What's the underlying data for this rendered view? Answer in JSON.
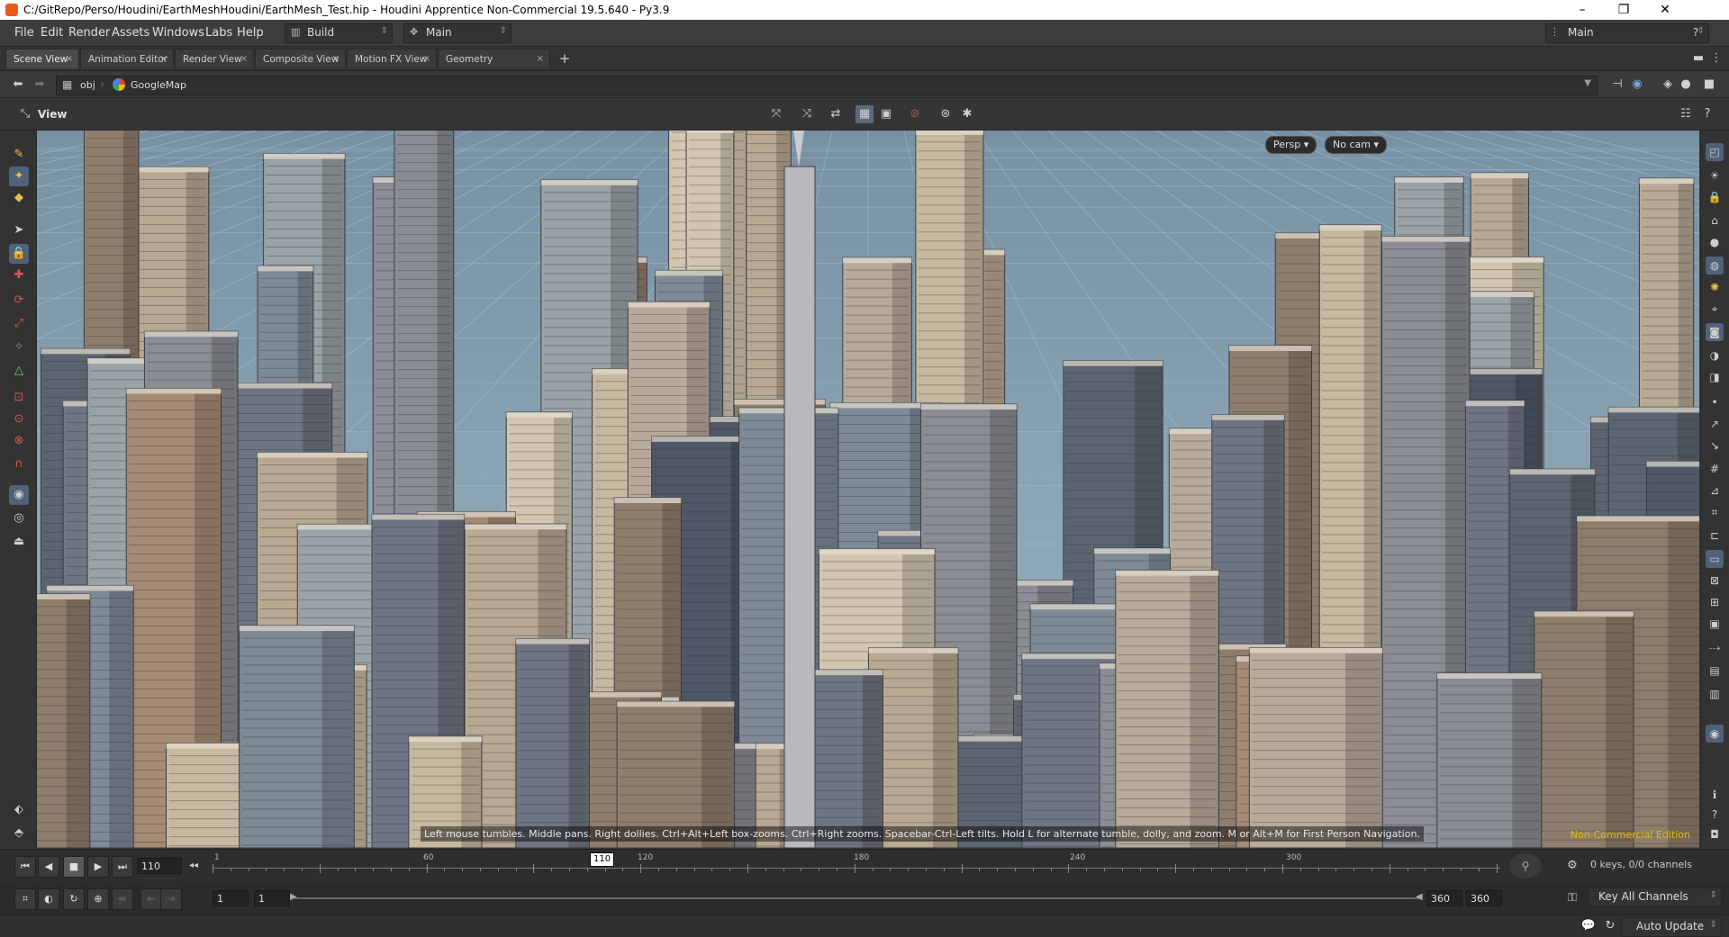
{
  "window": {
    "title": "C:/GitRepo/Perso/Houdini/EarthMeshHoudini/EarthMesh_Test.hip - Houdini Apprentice Non-Commercial 19.5.640 - Py3.9",
    "minimize": "–",
    "maximize": "❐",
    "close": "✕"
  },
  "menu": {
    "items": [
      "File",
      "Edit",
      "Render",
      "Assets",
      "Windows",
      "Labs",
      "Help"
    ],
    "desktop_combo": "Build",
    "context_combo": "Main",
    "right_combo": "Main"
  },
  "tabs": [
    {
      "label": "Scene View",
      "active": true
    },
    {
      "label": "Animation Editor",
      "active": false
    },
    {
      "label": "Render View",
      "active": false
    },
    {
      "label": "Composite View",
      "active": false
    },
    {
      "label": "Motion FX View",
      "active": false
    },
    {
      "label": "Geometry Spreadsheet",
      "active": false
    }
  ],
  "tab_add": "+",
  "path": {
    "root": "obj",
    "node": "GoogleMap"
  },
  "viewer": {
    "label": "View",
    "persp": "Persp ▾",
    "cam": "No cam ▾",
    "hint": "Left mouse tumbles. Middle pans. Right dollies. Ctrl+Alt+Left box-zooms. Ctrl+Right zooms. Spacebar-Ctrl-Left tilts. Hold L for alternate tumble, dolly, and zoom.    M or Alt+M for First Person Navigation.",
    "edition": "Non-Commercial Edition"
  },
  "timeline": {
    "current_frame": "110",
    "marker": "110",
    "ticks": [
      "1",
      "60",
      "120",
      "180",
      "240",
      "300"
    ],
    "keys_info": "0 keys, 0/0 channels",
    "key_all": "Key All Channels"
  },
  "range": {
    "start": "1",
    "start2": "1",
    "end": "360",
    "end2": "360"
  },
  "status": {
    "auto_update": "Auto Update"
  },
  "colors": {
    "accent": "#50627a",
    "sky": "#8ca6b6",
    "edition": "#e0c000"
  }
}
